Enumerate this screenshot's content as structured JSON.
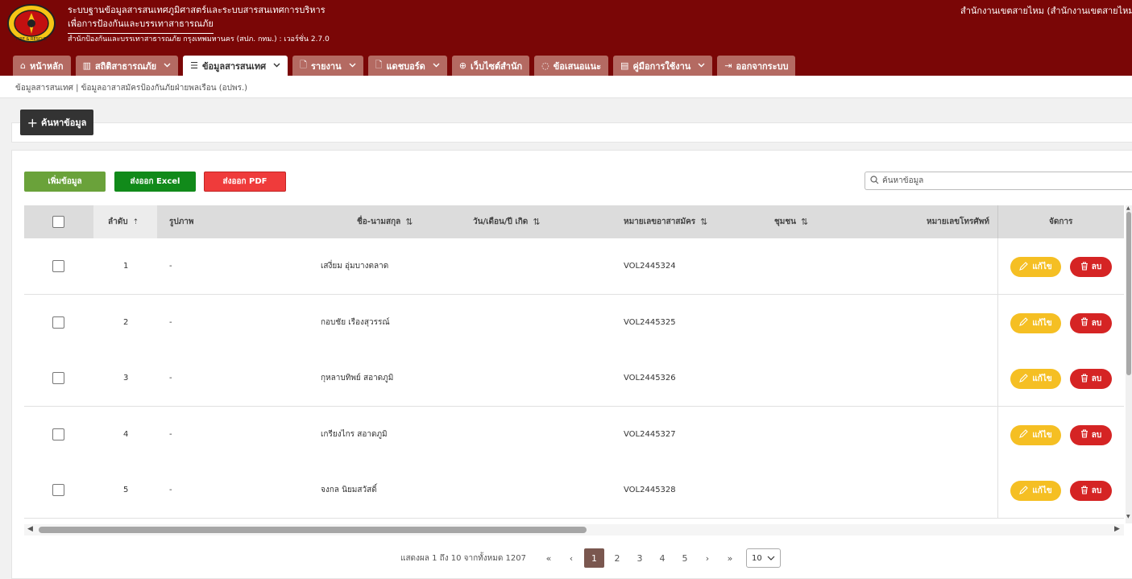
{
  "header": {
    "title_line1": "ระบบฐานข้อมูลสารสนเทศภูมิศาสตร์และระบบสารสนเทศการบริหาร",
    "title_line2": "เพื่อการป้องกันและบรรเทาสาธารณภัย",
    "subtitle": "สำนักป้องกันและบรรเทาสาธารณภัย กรุงเทพมหานคร (สปภ. กทม.) : เวอร์ชั่น 2.7.0",
    "user_label": "สำนักงานเขตสายไหม (สำนักงานเขตสายไหม)",
    "logo_text": "FIRE & RESCUE"
  },
  "nav": {
    "items": [
      {
        "label": "หน้าหลัก",
        "icon": "home-icon",
        "glyph": "⌂",
        "dropdown": false,
        "active": false
      },
      {
        "label": "สถิติสาธารณภัย",
        "icon": "bar-chart-icon",
        "glyph": "▥",
        "dropdown": true,
        "active": false
      },
      {
        "label": "ข้อมูลสารสนเทศ",
        "icon": "list-icon",
        "glyph": "☰",
        "dropdown": true,
        "active": true
      },
      {
        "label": "รายงาน",
        "icon": "file-icon",
        "glyph": "🗋",
        "dropdown": true,
        "active": false
      },
      {
        "label": "แดชบอร์ด",
        "icon": "file-icon",
        "glyph": "🗋",
        "dropdown": true,
        "active": false
      },
      {
        "label": "เว็บไซต์สำนัก",
        "icon": "globe-icon",
        "glyph": "⊕",
        "dropdown": false,
        "active": false
      },
      {
        "label": "ข้อเสนอแนะ",
        "icon": "chat-icon",
        "glyph": "◌",
        "dropdown": false,
        "active": false
      },
      {
        "label": "คู่มือการใช้งาน",
        "icon": "book-icon",
        "glyph": "▤",
        "dropdown": true,
        "active": false
      },
      {
        "label": "ออกจากระบบ",
        "icon": "logout-icon",
        "glyph": "⇥",
        "dropdown": false,
        "active": false
      }
    ]
  },
  "breadcrumb": "ข้อมูลสารสนเทศ | ข้อมูลอาสาสมัครป้องกันภัยฝ่ายพลเรือน (อปพร.)",
  "search_toggle": {
    "label": "ค้นหาข้อมูล",
    "icon": "plus-icon"
  },
  "toolbar": {
    "add_label": "เพิ่มข้อมูล",
    "excel_label": "ส่งออก Excel",
    "pdf_label": "ส่งออก PDF",
    "search_placeholder": "ค้นหาข้อมูล"
  },
  "table": {
    "headers": {
      "index": "ลำดับ",
      "picture": "รูปภาพ",
      "name": "ชื่อ-นามสกุล",
      "birthdate": "วัน/เดือน/ปี เกิด",
      "volunteer_no": "หมายเลขอาสาสมัคร",
      "community": "ชุมชน",
      "phone": "หมายเลขโทรศัพท์",
      "manage": "จัดการ"
    },
    "edit_label": "แก้ไข",
    "delete_label": "ลบ",
    "rows": [
      {
        "index": "1",
        "picture": "-",
        "name": "เสงี่ยม อุ่มบางตลาด",
        "volunteer_no": "VOL2445324"
      },
      {
        "index": "2",
        "picture": "-",
        "name": "กอบชัย เรืองสุวรรณ์",
        "volunteer_no": "VOL2445325"
      },
      {
        "index": "3",
        "picture": "-",
        "name": "กุหลาบทิพย์ สอาดภูมิ",
        "volunteer_no": "VOL2445326"
      },
      {
        "index": "4",
        "picture": "-",
        "name": "เกรียงไกร สอาดภูมิ",
        "volunteer_no": "VOL2445327"
      },
      {
        "index": "5",
        "picture": "-",
        "name": "จงกล นิยมสวัสดิ์",
        "volunteer_no": "VOL2445328"
      }
    ]
  },
  "pagination": {
    "info": "แสดงผล 1 ถึง 10 จากทั้งหมด 1207",
    "first": "«",
    "prev": "‹",
    "pages": [
      "1",
      "2",
      "3",
      "4",
      "5"
    ],
    "current": "1",
    "next": "›",
    "last": "»",
    "page_size": "10"
  },
  "colors": {
    "header_bg": "#7a0606",
    "nav_inactive": "#b46a62",
    "add_green": "#6aa23a",
    "excel_green": "#118a1a",
    "pdf_red": "#ef3b3b",
    "edit_yellow": "#f5bf23",
    "delete_red": "#d52424",
    "page_active": "#7a574f"
  }
}
